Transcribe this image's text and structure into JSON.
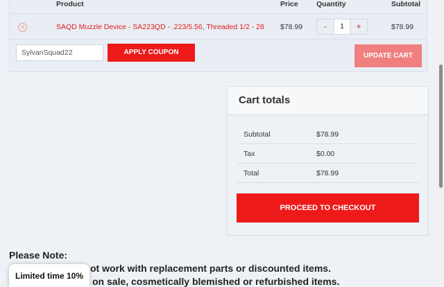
{
  "cart": {
    "headers": {
      "product": "Product",
      "price": "Price",
      "quantity": "Quantity",
      "subtotal": "Subtotal"
    },
    "item": {
      "remove_icon": "x-circle-icon",
      "name": "SAQD Muzzle Device - SA223QD - .223/5.56, Threaded 1/2 - 28",
      "price": "$78.99",
      "qty_minus": "-",
      "qty_value": "1",
      "qty_plus": "+",
      "subtotal": "$78.99"
    },
    "coupon": {
      "value": "SylvanSquad22",
      "apply_label": "APPLY COUPON"
    },
    "update_label": "UPDATE CART"
  },
  "totals": {
    "title": "Cart totals",
    "rows": [
      {
        "label": "Subtotal",
        "value": "$78.99"
      },
      {
        "label": "Tax",
        "value": "$0.00"
      },
      {
        "label": "Total",
        "value": "$78.99"
      }
    ],
    "checkout_label": "PROCEED TO CHECKOUT"
  },
  "note": {
    "title": "Please Note:",
    "line1": "ot work with replacement parts or discounted items.",
    "line2": "on sale, cosmetically blemished or refurbished items."
  },
  "promo": {
    "label": "Limited time 10%"
  },
  "colors": {
    "accent": "#ee1a1a",
    "update_button": "#f08080",
    "background": "#eef2f6"
  }
}
